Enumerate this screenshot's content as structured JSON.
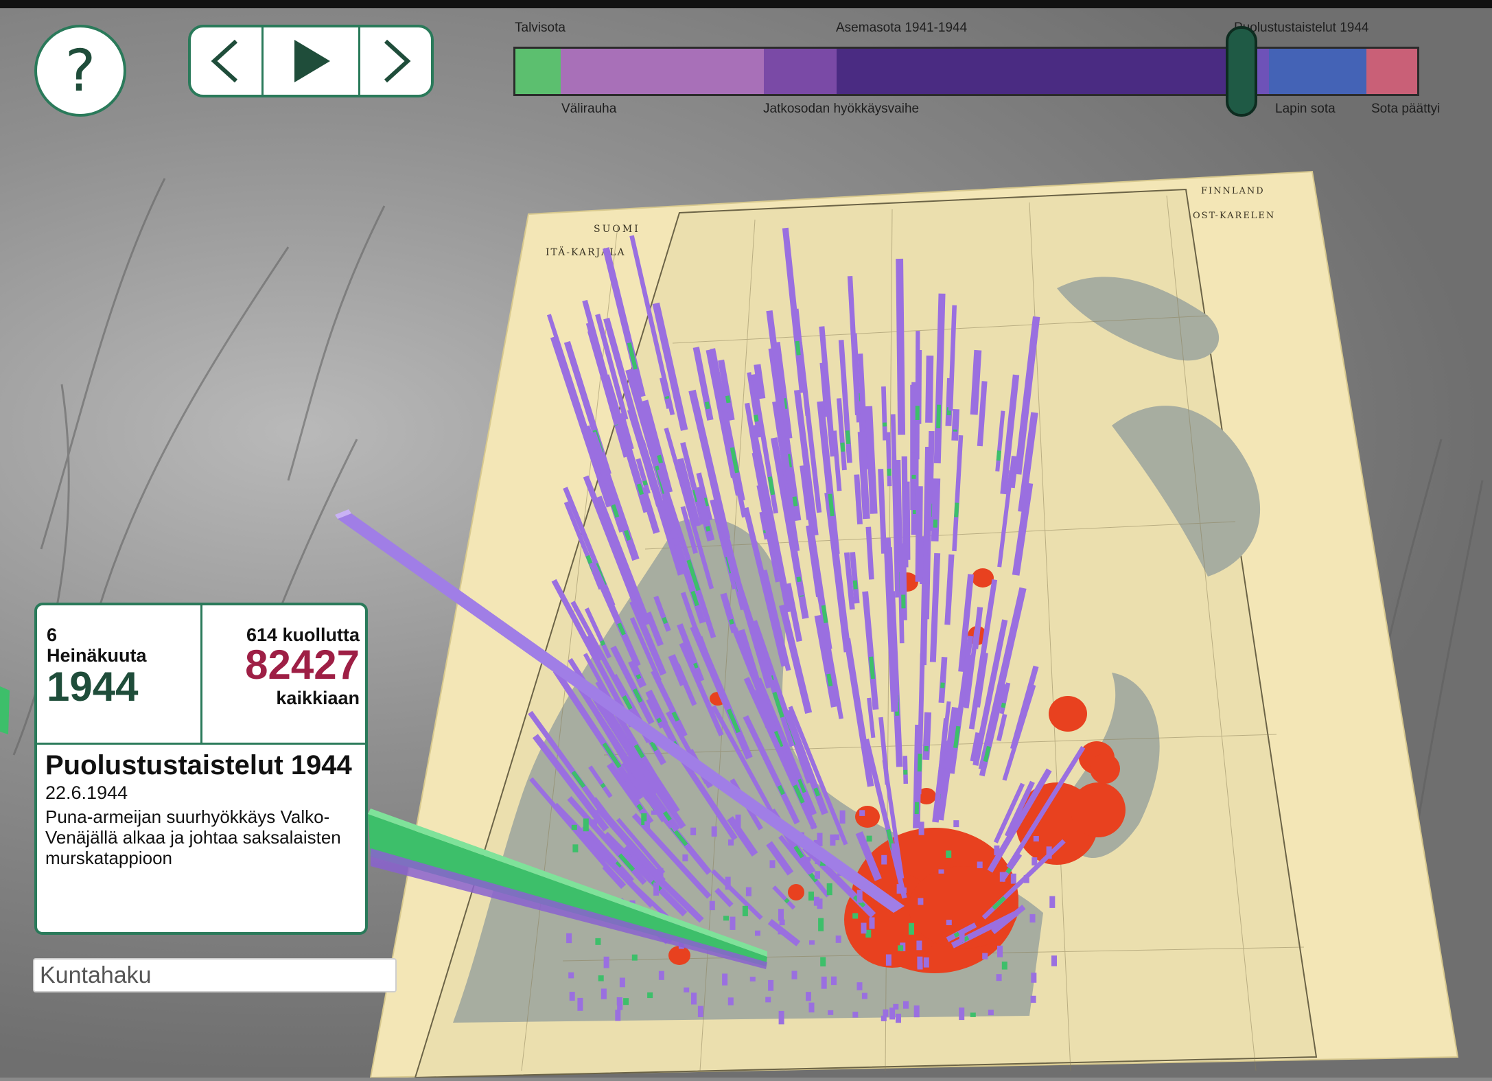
{
  "help": {
    "label": "?"
  },
  "playback": {
    "prev_icon": "chevron-left-icon",
    "play_icon": "play-icon",
    "next_icon": "chevron-right-icon"
  },
  "timeline": {
    "top_labels": [
      "Talvisota",
      "Asemasota 1941-1944",
      "Puolustustaistelut 1944"
    ],
    "bottom_labels": [
      "Välirauha",
      "Jatkosodan hyökkäysvaihe",
      "Lapin sota",
      "Sota päättyi"
    ],
    "segments": [
      {
        "name": "Talvisota",
        "color": "#5cbf6f"
      },
      {
        "name": "Välirauha",
        "color": "#a870b8"
      },
      {
        "name": "Jatkosodan hyökkäysvaihe",
        "color": "#7a4aa6"
      },
      {
        "name": "Asemasota 1941-1944",
        "color": "#4a2b82"
      },
      {
        "name": "Puolustustaistelut 1944",
        "color": "#6e52b8"
      },
      {
        "name": "Lapin sota",
        "color": "#4463b6"
      },
      {
        "name": "Sota päättyi",
        "color": "#c96077"
      }
    ],
    "handle_icon": "timeline-handle-icon"
  },
  "map": {
    "title_fi_line1": "SUOMI",
    "title_fi_line2": "ITÄ-KARJALA",
    "title_de_line1": "FINNLAND",
    "title_de_line2": "OST-KARELEN",
    "colors": {
      "paper": "#f3e6b6",
      "sea": "#a7ada0",
      "casualty_bar": "#9a6fe0",
      "bar_accent": "#3dbf6a",
      "front_blob": "#e8411f"
    }
  },
  "info": {
    "day": "6",
    "month": "Heinäkuuta",
    "year": "1944",
    "dead_today": "614 kuollutta",
    "dead_total": "82427",
    "dead_total_label": "kaikkiaan",
    "event_title": "Puolustustaistelut 1944",
    "event_date": "22.6.1944",
    "event_desc": "Puna-armeijan suurhyökkäys Valko-Venäjällä alkaa ja johtaa saksalaisten murskatappioon"
  },
  "search": {
    "placeholder": "Kuntahaku"
  }
}
